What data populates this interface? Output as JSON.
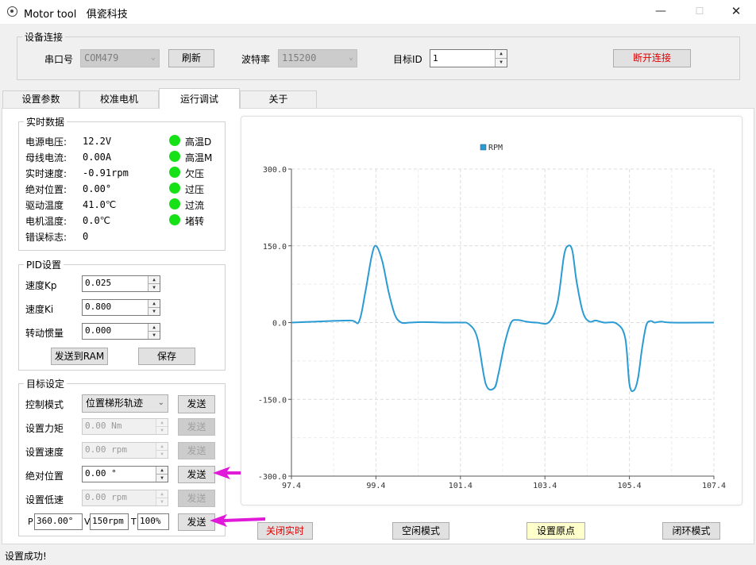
{
  "window": {
    "app_name": "Motor tool",
    "vendor": "俱瓷科技",
    "min": "—",
    "max": "☐",
    "close": "✕"
  },
  "connection": {
    "group_title": "设备连接",
    "port_label": "串口号",
    "port_value": "COM479",
    "refresh": "刷新",
    "baud_label": "波特率",
    "baud_value": "115200",
    "target_id_label": "目标ID",
    "target_id_value": "1",
    "disconnect": "断开连接"
  },
  "tabs": [
    {
      "label": "设置参数",
      "active": false
    },
    {
      "label": "校准电机",
      "active": false
    },
    {
      "label": "运行调试",
      "active": true
    },
    {
      "label": "关于",
      "active": false
    }
  ],
  "realtime": {
    "title": "实时数据",
    "rows": [
      {
        "label": "电源电压:",
        "value": "12.2V"
      },
      {
        "label": "母线电流:",
        "value": "0.00A"
      },
      {
        "label": "实时速度:",
        "value": "-0.91rpm"
      },
      {
        "label": "绝对位置:",
        "value": "0.00°"
      },
      {
        "label": "驱动温度",
        "value": "41.0℃"
      },
      {
        "label": "电机温度:",
        "value": "0.0℃"
      },
      {
        "label": "错误标志:",
        "value": "0"
      }
    ],
    "indicators": [
      {
        "label": "高温D",
        "color": "#16e016"
      },
      {
        "label": "高温M",
        "color": "#16e016"
      },
      {
        "label": "欠压",
        "color": "#16e016"
      },
      {
        "label": "过压",
        "color": "#16e016"
      },
      {
        "label": "过流",
        "color": "#16e016"
      },
      {
        "label": "堵转",
        "color": "#16e016"
      }
    ]
  },
  "pid": {
    "title": "PID设置",
    "kp_label": "速度Kp",
    "kp_value": "0.025",
    "ki_label": "速度Ki",
    "ki_value": "0.800",
    "inertia_label": "转动惯量",
    "inertia_value": "0.000",
    "send_ram": "发送到RAM",
    "save": "保存"
  },
  "target": {
    "title": "目标设定",
    "mode_label": "控制模式",
    "mode_value": "位置梯形轨迹",
    "torque_label": "设置力矩",
    "torque_value": "0.00 Nm",
    "speed_label": "设置速度",
    "speed_value": "0.00 rpm",
    "position_label": "绝对位置",
    "position_value": "0.00 °",
    "low_speed_label": "设置低速",
    "low_speed_value": "0.00 rpm",
    "send": "发送",
    "traj_p_label": "P",
    "traj_p_value": "360.00°",
    "traj_v_label": "V",
    "traj_v_value": "150rpm",
    "traj_t_label": "T",
    "traj_t_value": "100%"
  },
  "actions": {
    "close_realtime": "关闭实时",
    "idle_mode": "空闲模式",
    "set_origin": "设置原点",
    "closed_loop": "闭环模式"
  },
  "status": "设置成功!",
  "colors": {
    "accent_red": "#e00000",
    "led_green": "#16e016",
    "series": "#2b9bd3",
    "arrow": "#e01ad8",
    "origin_button_bg": "#ffffcc"
  },
  "chart_data": {
    "type": "line",
    "title": "",
    "xlabel": "",
    "ylabel": "",
    "legend_position": "top-center",
    "grid": true,
    "xlim": [
      97.4,
      107.4
    ],
    "ylim": [
      -300,
      300
    ],
    "x_ticks": [
      "97.4",
      "99.4",
      "101.4",
      "103.4",
      "105.4",
      "107.4"
    ],
    "y_ticks": [
      "300.0",
      "150.0",
      "0.0",
      "-150.0",
      "-300.0"
    ],
    "series": [
      {
        "name": "RPM",
        "x": [
          97.4,
          98.0,
          98.8,
          99.0,
          99.15,
          99.3,
          99.4,
          99.55,
          99.7,
          99.85,
          100.0,
          100.2,
          100.5,
          101.0,
          101.4,
          101.6,
          101.8,
          102.0,
          102.2,
          102.3,
          102.45,
          102.6,
          102.75,
          102.95,
          103.2,
          103.5,
          103.7,
          103.85,
          103.95,
          104.05,
          104.15,
          104.3,
          104.45,
          104.6,
          104.8,
          105.1,
          105.3,
          105.4,
          105.5,
          105.6,
          105.7,
          105.8,
          105.9,
          106.0,
          106.15,
          106.4,
          107.4
        ],
        "y": [
          0,
          2,
          4,
          2,
          60,
          130,
          150,
          120,
          60,
          15,
          0,
          0,
          1,
          0,
          0,
          -3,
          -30,
          -120,
          -128,
          -100,
          -40,
          0,
          5,
          2,
          0,
          1,
          40,
          130,
          150,
          140,
          80,
          20,
          2,
          4,
          0,
          -2,
          -30,
          -120,
          -133,
          -110,
          -50,
          -5,
          3,
          0,
          2,
          0,
          0
        ]
      }
    ]
  }
}
